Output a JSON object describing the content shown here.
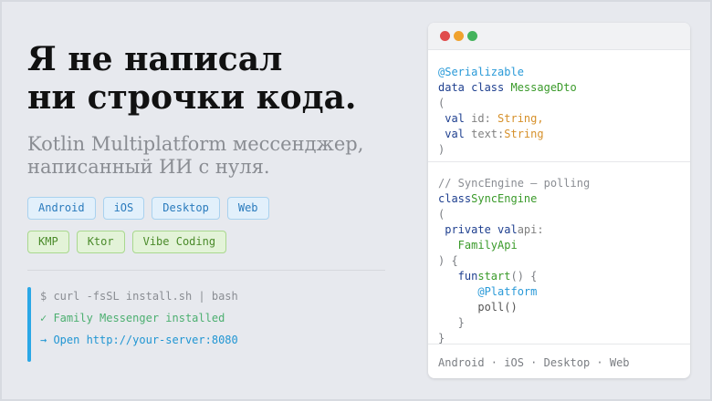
{
  "hero": {
    "title_line1": "Я не написал",
    "title_line2": "ни строчки кода.",
    "subtitle_line1": "Kotlin Multiplatform мессенджер,",
    "subtitle_line2": "написанный ИИ с нуля."
  },
  "platform_tags": [
    "Android",
    "iOS",
    "Desktop",
    "Web"
  ],
  "tech_tags": [
    "KMP",
    "Ktor",
    "Vibe Coding"
  ],
  "terminal": {
    "cmd": "$ curl -fsSL install.sh | bash",
    "ok": "✓ Family Messenger installed",
    "open": "→ Open http://your-server:8080"
  },
  "code": {
    "l1": "@Serializable",
    "l2_kw": "data class ",
    "l2_type": "MessageDto",
    "l3": "(",
    "l4_kw": " val ",
    "l4_id": "id:",
    "l4_type": " String,",
    "l5_kw": " val ",
    "l5_id": "text:",
    "l5_type": "String",
    "l6": ")",
    "m1": "// SyncEngine — polling",
    "m2_kw": "class",
    "m2_type": "SyncEngine",
    "m3": "(",
    "m4_kw": " private val",
    "m4_id": "api:",
    "m5_type": "   FamilyApi",
    "m6": ") {",
    "m7_kw": "   fun",
    "m7_fn": "start",
    "m7_rest": "() {",
    "m8_ann": "      @Platform",
    "m9": "      poll()",
    "m10": "   }",
    "m11": "}"
  },
  "footer": "Android · iOS · Desktop · Web",
  "colors": {
    "accent_blue": "#2aa7e6",
    "ok_green": "#4caf70",
    "dot_red": "#e04c4c",
    "dot_yellow": "#f0a22e",
    "dot_green": "#44b35c"
  }
}
